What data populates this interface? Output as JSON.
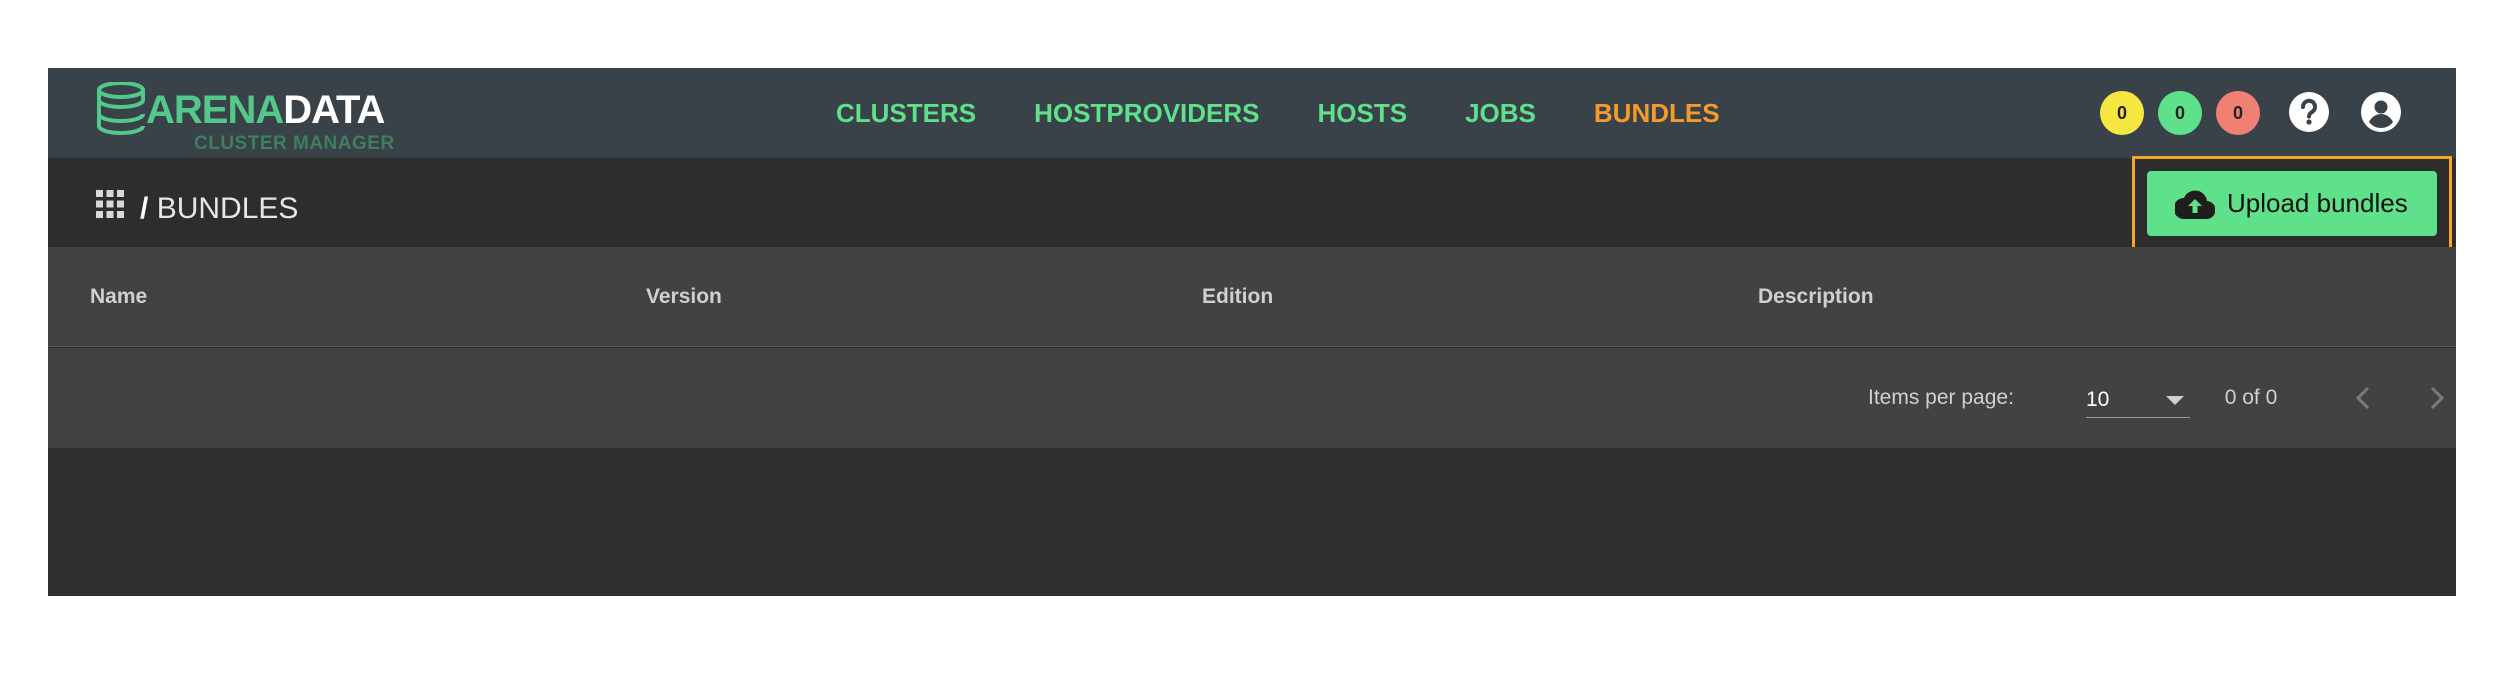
{
  "logo": {
    "word_arena": "ARENA",
    "word_data": "DATA",
    "subtitle": "CLUSTER MANAGER"
  },
  "nav": [
    {
      "label": "CLUSTERS",
      "active": false
    },
    {
      "label": "HOSTPROVIDERS",
      "active": false
    },
    {
      "label": "HOSTS",
      "active": false
    },
    {
      "label": "JOBS",
      "active": false
    },
    {
      "label": "BUNDLES",
      "active": true
    }
  ],
  "status": {
    "warning": "0",
    "success": "0",
    "failed": "0"
  },
  "breadcrumb": {
    "separator": "/",
    "current": "BUNDLES"
  },
  "actions": {
    "upload_label": "Upload bundles"
  },
  "table": {
    "columns": [
      "Name",
      "Version",
      "Edition",
      "Description"
    ],
    "rows": []
  },
  "paginator": {
    "items_per_page_label": "Items per page:",
    "items_per_page": "10",
    "range": "0 of 0"
  },
  "colors": {
    "accent_green": "#5fe08a",
    "active_nav": "#f39c2d",
    "highlight": "#f5a623"
  }
}
